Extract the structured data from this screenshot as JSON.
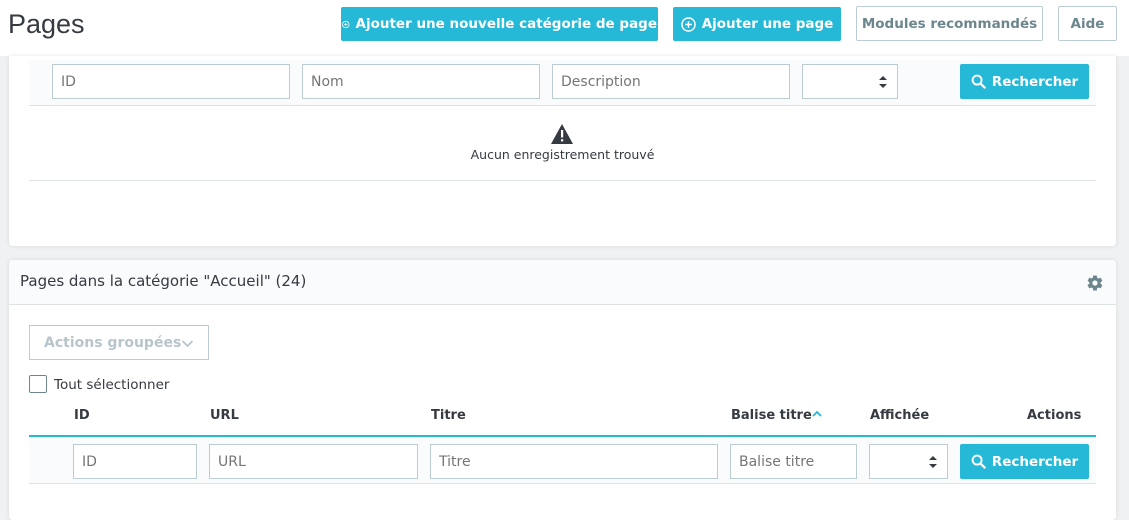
{
  "header": {
    "title": "Pages",
    "add_category_label": "Ajouter une nouvelle catégorie de page",
    "add_page_label": "Ajouter une page",
    "recommended_modules_label": "Modules recommandés",
    "help_label": "Aide"
  },
  "categories_table": {
    "filters": {
      "id_placeholder": "ID",
      "name_placeholder": "Nom",
      "description_placeholder": "Description",
      "search_label": "Rechercher"
    },
    "empty_message": "Aucun enregistrement trouvé"
  },
  "pages_table": {
    "title": "Pages dans la catégorie \"Accueil\" (24)",
    "bulk_actions_label": "Actions groupées",
    "select_all_label": "Tout sélectionner",
    "columns": [
      "ID",
      "URL",
      "Titre",
      "Balise titre",
      "Affichée",
      "Actions"
    ],
    "filters": {
      "id_placeholder": "ID",
      "url_placeholder": "URL",
      "title_placeholder": "Titre",
      "meta_title_placeholder": "Balise titre",
      "search_label": "Rechercher"
    }
  },
  "colors": {
    "accent": "#25b9d7",
    "text": "#363a41",
    "border": "#bbcdd2"
  }
}
